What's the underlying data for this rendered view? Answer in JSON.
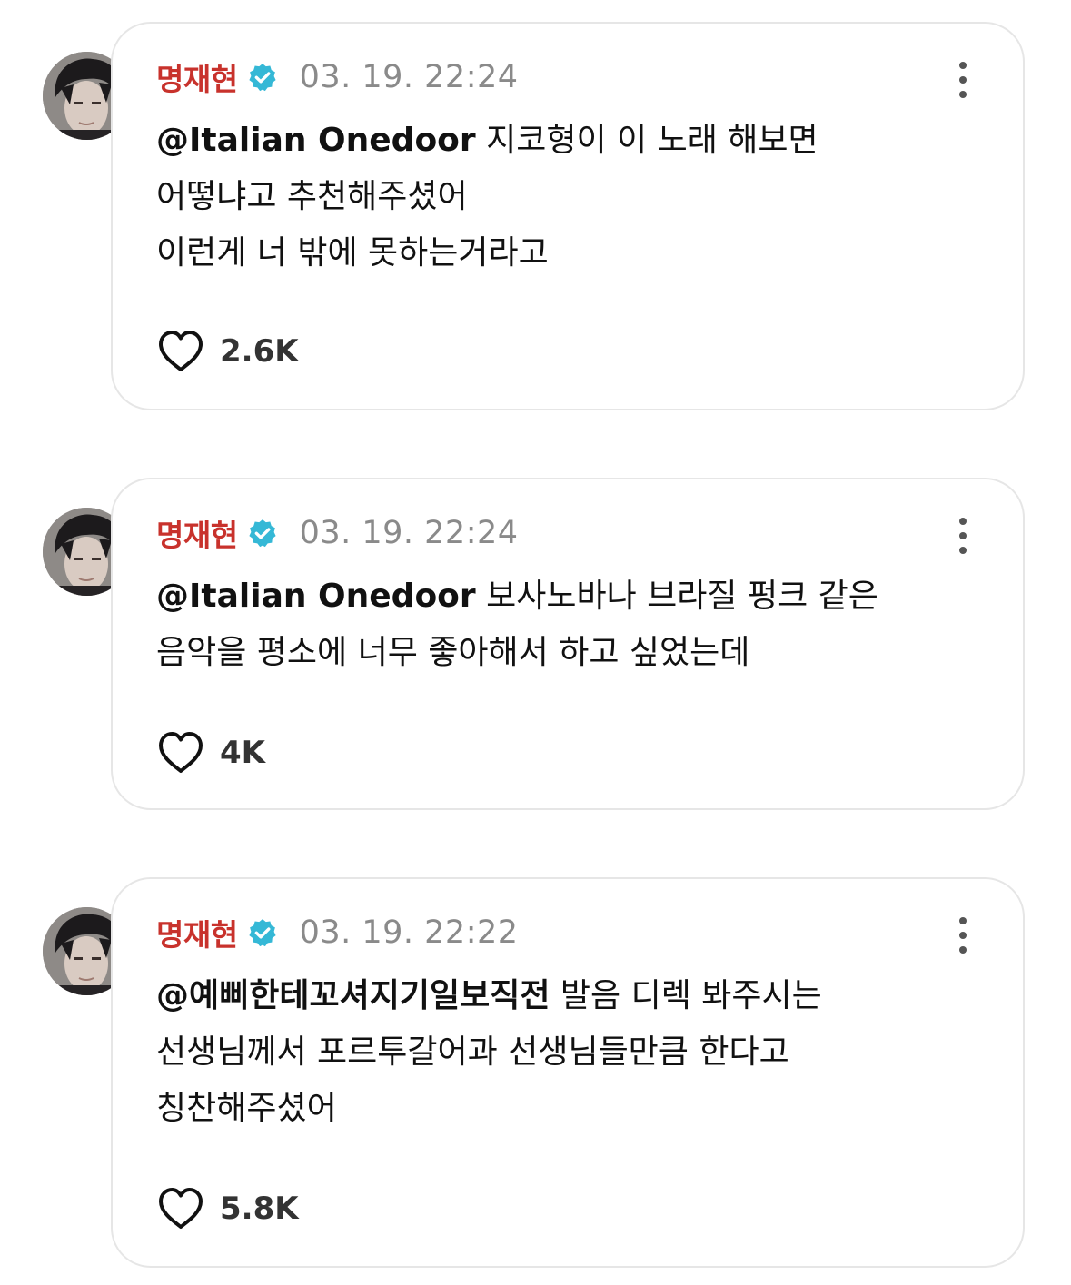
{
  "posts": [
    {
      "author": "명재현",
      "timestamp": "03. 19. 22:24",
      "mention": "@Italian Onedoor",
      "first_line_rest": " 지코형이 이 노래 해보면",
      "lines": [
        "어떻냐고 추천해주셨어",
        "이런게 너 밖에 못하는거라고"
      ],
      "likes": "2.6K"
    },
    {
      "author": "명재현",
      "timestamp": "03. 19. 22:24",
      "mention": "@Italian Onedoor",
      "first_line_rest": " 보사노바나 브라질 펑크 같은",
      "lines": [
        "음악을 평소에 너무 좋아해서 하고 싶었는데"
      ],
      "likes": "4K"
    },
    {
      "author": "명재현",
      "timestamp": "03. 19. 22:22",
      "mention": "@예삐한테꼬셔지기일보직전",
      "first_line_rest": " 발음 디렉 봐주시는",
      "lines": [
        "선생님께서 포르투갈어과 선생님들만큼 한다고",
        "칭찬해주셨어"
      ],
      "likes": "5.8K"
    }
  ],
  "icons": {
    "verified": "verified-badge-icon",
    "more": "more-vertical-icon",
    "like": "heart-outline-icon"
  },
  "colors": {
    "author": "#c8322c",
    "verified": "#35b8d6",
    "timestamp": "#8a8a8a",
    "card_border": "#e6e6e6"
  }
}
